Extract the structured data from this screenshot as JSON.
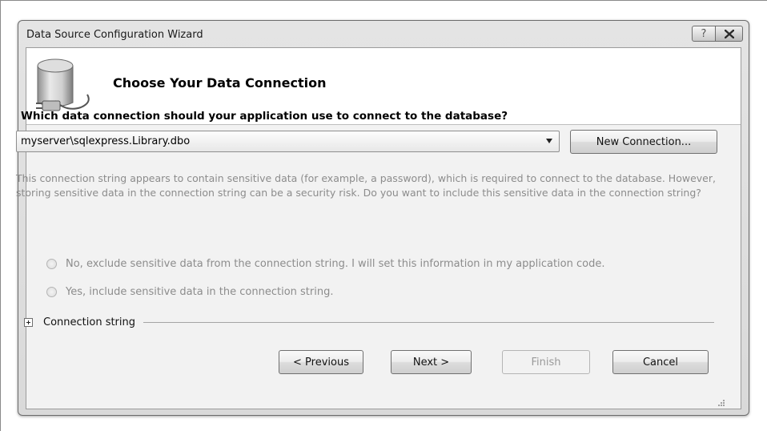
{
  "window": {
    "title": "Data Source Configuration Wizard",
    "help_label": "?",
    "close_label": "✖"
  },
  "header": {
    "title": "Choose Your Data Connection",
    "icon": "database-plug-icon"
  },
  "connection": {
    "question": "Which data connection should your application use to connect to the database?",
    "selected_value": "myserver\\sqlexpress.Library.dbo",
    "new_connection_label": "New Connection..."
  },
  "sensitive": {
    "info": "This connection string appears to contain sensitive data (for example, a password), which is required to connect to the database. However, storing sensitive data in the connection string can be a security risk. Do you want to include this sensitive data in the connection string?",
    "option_no": "No, exclude sensitive data from the connection string. I will set this information in my application code.",
    "option_yes": "Yes, include sensitive data in the connection string."
  },
  "connection_string": {
    "label": "Connection string",
    "expander_icon": "plus-icon"
  },
  "footer": {
    "previous_label": "< Previous",
    "next_label": "Next >",
    "finish_label": "Finish",
    "cancel_label": "Cancel"
  }
}
